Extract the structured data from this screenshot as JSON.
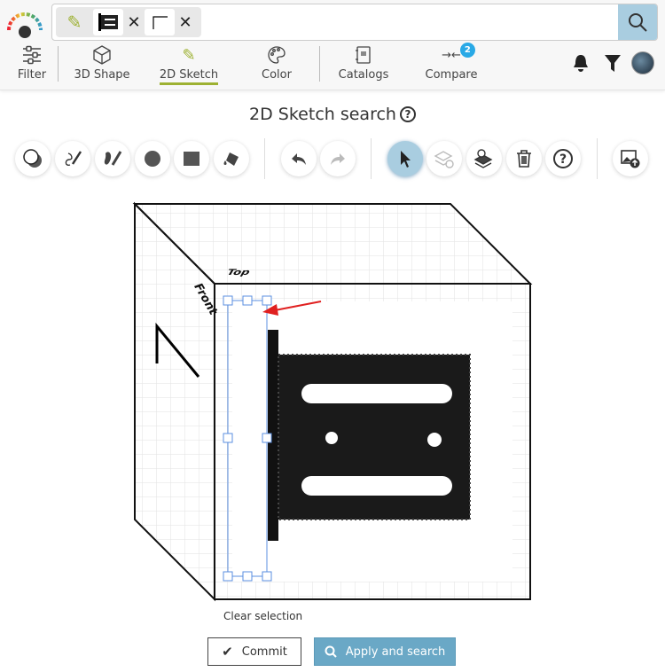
{
  "header": {
    "search_chips": [
      {
        "type": "sketch-thumbnail"
      },
      {
        "type": "sketch-thumbnail"
      }
    ],
    "nav": [
      {
        "label": "Filter",
        "icon": "sliders-icon"
      },
      {
        "label": "3D Shape",
        "icon": "cube-icon"
      },
      {
        "label": "2D Sketch",
        "icon": "pencil-icon",
        "active": true
      },
      {
        "label": "Color",
        "icon": "palette-icon"
      },
      {
        "label": "Catalogs",
        "icon": "catalog-icon"
      },
      {
        "label": "Compare",
        "icon": "compare-icon",
        "badge": "2"
      }
    ],
    "accent": "#9db132"
  },
  "page": {
    "title": "2D Sketch search",
    "help": "?",
    "cube_labels": {
      "top": "Top",
      "front": "Front"
    },
    "clear_selection": "Clear selection",
    "commit": "Commit",
    "apply": "Apply and search"
  }
}
